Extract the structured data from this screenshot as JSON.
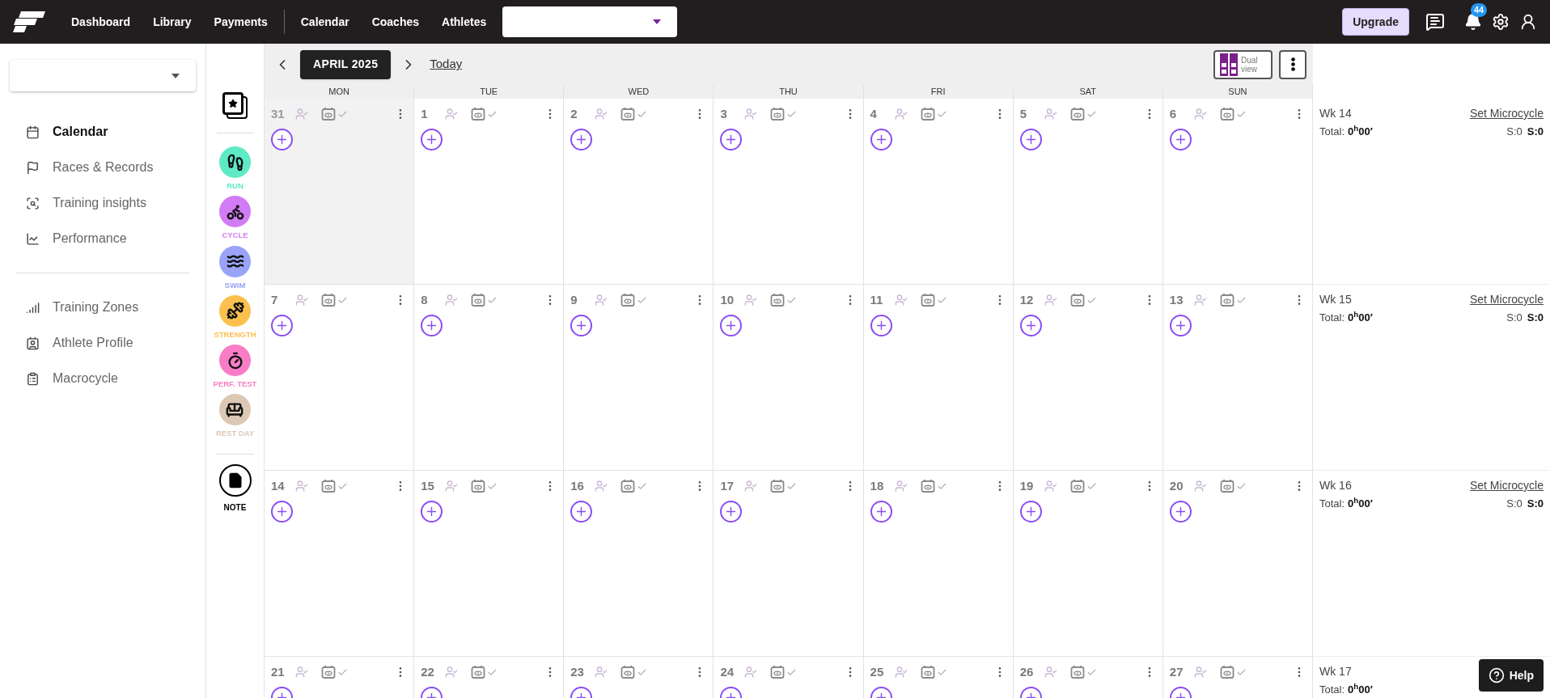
{
  "top_nav": {
    "primary_links": [
      {
        "label": "Dashboard"
      },
      {
        "label": "Library"
      },
      {
        "label": "Payments"
      }
    ],
    "secondary_links": [
      {
        "label": "Calendar"
      },
      {
        "label": "Coaches"
      },
      {
        "label": "Athletes"
      }
    ],
    "upgrade_button": "Upgrade",
    "notification_count": "44"
  },
  "sidebar": {
    "sections": [
      {
        "items": [
          {
            "label": "Calendar",
            "selected": true
          },
          {
            "label": "Races & Records",
            "selected": false
          },
          {
            "label": "Training insights",
            "selected": false
          },
          {
            "label": "Performance",
            "selected": false
          }
        ]
      },
      {
        "items": [
          {
            "label": "Training Zones",
            "selected": false
          },
          {
            "label": "Athlete Profile",
            "selected": false
          },
          {
            "label": "Macrocycle",
            "selected": false
          }
        ]
      }
    ]
  },
  "palette": {
    "items": [
      {
        "kind": "run",
        "label": "RUN",
        "color": "#5eeac4"
      },
      {
        "kind": "cycle",
        "label": "CYCLE",
        "color": "#d17cf4"
      },
      {
        "kind": "swim",
        "label": "SWIM",
        "color": "#99a3f7"
      },
      {
        "kind": "strength",
        "label": "STRENGTH",
        "color": "#fcc04e"
      },
      {
        "kind": "perf_test",
        "label": "PERF. TEST",
        "color": "#f87dc6"
      },
      {
        "kind": "rest_day",
        "label": "REST DAY",
        "color": "#dcc8b4"
      }
    ],
    "note_label": "NOTE"
  },
  "calendar": {
    "month": "APRIL 2025",
    "today_link": "Today",
    "dual_view": "Dual view",
    "weekdays": [
      "MON",
      "TUE",
      "WED",
      "THU",
      "FRI",
      "SAT",
      "SUN"
    ],
    "weeks": [
      {
        "days": [
          {
            "day": "31",
            "outside_month": true
          },
          {
            "day": "1",
            "outside_month": false
          },
          {
            "day": "2",
            "outside_month": false
          },
          {
            "day": "3",
            "outside_month": false
          },
          {
            "day": "4",
            "outside_month": false
          },
          {
            "day": "5",
            "outside_month": false
          },
          {
            "day": "6",
            "outside_month": false
          }
        ],
        "week_label": "Wk 14",
        "total_label": "Total:",
        "total_value": "0$^{h}$00′",
        "set_microcycle": "Set Microcycle",
        "stats": [
          {
            "text": "S:0",
            "bold": false
          },
          {
            "text": "S:0",
            "bold": true
          }
        ]
      },
      {
        "days": [
          {
            "day": "7",
            "outside_month": false
          },
          {
            "day": "8",
            "outside_month": false
          },
          {
            "day": "9",
            "outside_month": false
          },
          {
            "day": "10",
            "outside_month": false
          },
          {
            "day": "11",
            "outside_month": false
          },
          {
            "day": "12",
            "outside_month": false
          },
          {
            "day": "13",
            "outside_month": false
          }
        ],
        "week_label": "Wk 15",
        "total_label": "Total:",
        "total_value": "0$^{h}$00′",
        "set_microcycle": "Set Microcycle",
        "stats": [
          {
            "text": "S:0",
            "bold": false
          },
          {
            "text": "S:0",
            "bold": true
          }
        ]
      },
      {
        "days": [
          {
            "day": "14",
            "outside_month": false
          },
          {
            "day": "15",
            "outside_month": false
          },
          {
            "day": "16",
            "outside_month": false
          },
          {
            "day": "17",
            "outside_month": false
          },
          {
            "day": "18",
            "outside_month": false
          },
          {
            "day": "19",
            "outside_month": false
          },
          {
            "day": "20",
            "outside_month": false
          }
        ],
        "week_label": "Wk 16",
        "total_label": "Total:",
        "total_value": "0$^{h}$00′",
        "set_microcycle": "Set Microcycle",
        "stats": [
          {
            "text": "S:0",
            "bold": false
          },
          {
            "text": "S:0",
            "bold": true
          }
        ]
      },
      {
        "days": [
          {
            "day": "21",
            "outside_month": false
          },
          {
            "day": "22",
            "outside_month": false
          },
          {
            "day": "23",
            "outside_month": false
          },
          {
            "day": "24",
            "outside_month": false
          },
          {
            "day": "25",
            "outside_month": false
          },
          {
            "day": "26",
            "outside_month": false
          },
          {
            "day": "27",
            "outside_month": false
          }
        ],
        "week_label": "Wk 17",
        "total_label": "Total:",
        "total_value": "0$^{h}$00′"
      }
    ]
  },
  "help_button": "Help"
}
